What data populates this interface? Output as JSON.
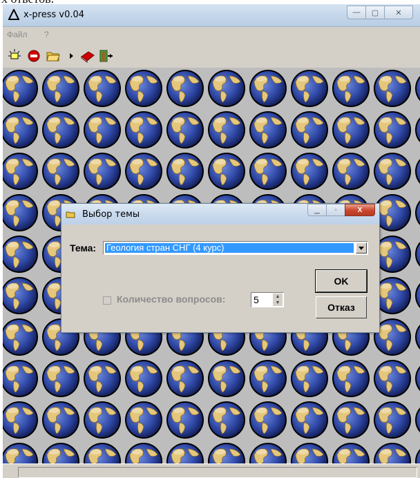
{
  "page_top_text": "х ответов.",
  "window": {
    "title": "x-press v0.04",
    "minimize": "—",
    "maximize": "▢",
    "close": "✕"
  },
  "menu": {
    "file": "Файл",
    "help": "?"
  },
  "toolbar": {
    "icons": [
      "lightbulb-icon",
      "stop-icon",
      "open-folder-icon",
      "arrow-right-icon",
      "book-icon",
      "exit-door-icon"
    ]
  },
  "dialog": {
    "title": "Выбор темы",
    "topic_label": "Тема:",
    "topic_value": "Геология стран СНГ (4 курс)",
    "ok_label": "OK",
    "cancel_label": "Отказ",
    "count_label": "Количество вопросов:",
    "count_value": "5",
    "count_checked": false
  },
  "colors": {
    "selection": "#3399ff",
    "face": "#d4d0c8",
    "close_red": "#c9462c"
  }
}
